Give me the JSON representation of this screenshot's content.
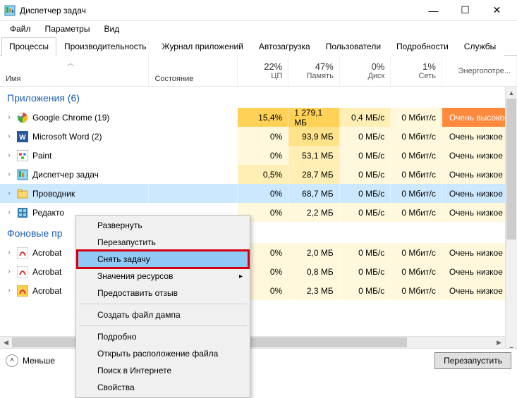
{
  "window": {
    "title": "Диспетчер задач"
  },
  "menubar": [
    "Файл",
    "Параметры",
    "Вид"
  ],
  "tabs": [
    "Процессы",
    "Производительность",
    "Журнал приложений",
    "Автозагрузка",
    "Пользователи",
    "Подробности",
    "Службы"
  ],
  "headers": {
    "name": "Имя",
    "state": "Состояние",
    "cpu": {
      "pct": "22%",
      "label": "ЦП"
    },
    "mem": {
      "pct": "47%",
      "label": "Память"
    },
    "disk": {
      "pct": "0%",
      "label": "Диск"
    },
    "net": {
      "pct": "1%",
      "label": "Сеть"
    },
    "energy": {
      "pct": "",
      "label": "Энергопотре..."
    }
  },
  "sections": {
    "apps": {
      "title": "Приложения (6)"
    },
    "bg": {
      "title": "Фоновые пр"
    }
  },
  "rows": [
    {
      "name": "Google Chrome (19)",
      "cpu": "15,4%",
      "mem": "1 279,1 МБ",
      "disk": "0,4 МБ/с",
      "net": "0 Мбит/с",
      "energy": "Очень высокое",
      "cpu_bg": "bg-y3",
      "mem_bg": "bg-y3",
      "disk_bg": "bg-y1",
      "net_bg": "bg-y0",
      "energy_bg": "bg-or",
      "icon": "chrome"
    },
    {
      "name": "Microsoft Word (2)",
      "cpu": "0%",
      "mem": "93,9 МБ",
      "disk": "0 МБ/с",
      "net": "0 Мбит/с",
      "energy": "Очень низкое",
      "cpu_bg": "bg-y0",
      "mem_bg": "bg-y2",
      "disk_bg": "bg-y0",
      "net_bg": "bg-y0",
      "energy_bg": "bg-y0",
      "icon": "word"
    },
    {
      "name": "Paint",
      "cpu": "0%",
      "mem": "53,1 МБ",
      "disk": "0 МБ/с",
      "net": "0 Мбит/с",
      "energy": "Очень низкое",
      "cpu_bg": "bg-y0",
      "mem_bg": "bg-y1",
      "disk_bg": "bg-y0",
      "net_bg": "bg-y0",
      "energy_bg": "bg-y0",
      "icon": "paint"
    },
    {
      "name": "Диспетчер задач",
      "cpu": "0,5%",
      "mem": "28,7 МБ",
      "disk": "0 МБ/с",
      "net": "0 Мбит/с",
      "energy": "Очень низкое",
      "cpu_bg": "bg-y1",
      "mem_bg": "bg-y1",
      "disk_bg": "bg-y0",
      "net_bg": "bg-y0",
      "energy_bg": "bg-y0",
      "icon": "taskmgr"
    },
    {
      "name": "Проводник",
      "cpu": "0%",
      "mem": "68,7 МБ",
      "disk": "0 МБ/с",
      "net": "0 Мбит/с",
      "energy": "Очень низкое",
      "cpu_bg": "bg-sel",
      "mem_bg": "bg-sel",
      "disk_bg": "bg-sel",
      "net_bg": "bg-sel",
      "energy_bg": "bg-sel",
      "icon": "explorer",
      "selected": true
    },
    {
      "name": "Редакто",
      "cpu": "0%",
      "mem": "2,2 МБ",
      "disk": "0 МБ/с",
      "net": "0 Мбит/с",
      "energy": "Очень низкое",
      "cpu_bg": "bg-y0",
      "mem_bg": "bg-y0",
      "disk_bg": "bg-y0",
      "net_bg": "bg-y0",
      "energy_bg": "bg-y0",
      "icon": "regedit"
    }
  ],
  "bg_rows": [
    {
      "name": "Acrobat",
      "cpu": "0%",
      "mem": "2,0 МБ",
      "disk": "0 МБ/с",
      "net": "0 Мбит/с",
      "energy": "Очень низкое",
      "cpu_bg": "bg-y0",
      "mem_bg": "bg-y0",
      "disk_bg": "bg-y0",
      "net_bg": "bg-y0",
      "energy_bg": "bg-y0",
      "icon": "acrobat"
    },
    {
      "name": "Acrobat",
      "cpu": "0%",
      "mem": "0,8 МБ",
      "disk": "0 МБ/с",
      "net": "0 Мбит/с",
      "energy": "Очень низкое",
      "cpu_bg": "bg-y0",
      "mem_bg": "bg-y0",
      "disk_bg": "bg-y0",
      "net_bg": "bg-y0",
      "energy_bg": "bg-y0",
      "icon": "acrobat"
    },
    {
      "name": "Acrobat",
      "cpu": "0%",
      "mem": "2,3 МБ",
      "disk": "0 МБ/с",
      "net": "0 Мбит/с",
      "energy": "Очень низкое",
      "cpu_bg": "bg-y0",
      "mem_bg": "bg-y0",
      "disk_bg": "bg-y0",
      "net_bg": "bg-y0",
      "energy_bg": "bg-y0",
      "icon": "acrobat2"
    }
  ],
  "context_menu": {
    "items": [
      {
        "label": "Развернуть"
      },
      {
        "label": "Перезапустить"
      },
      {
        "label": "Снять задачу",
        "highlighted": true
      },
      {
        "label": "Значения ресурсов",
        "submenu": true
      },
      {
        "label": "Предоставить отзыв"
      },
      {
        "sep": true
      },
      {
        "label": "Создать файл дампа"
      },
      {
        "sep": true
      },
      {
        "label": "Подробно"
      },
      {
        "label": "Открыть расположение файла"
      },
      {
        "label": "Поиск в Интернете"
      },
      {
        "label": "Свойства"
      }
    ]
  },
  "footer": {
    "less": "Меньше",
    "action": "Перезапустить"
  }
}
